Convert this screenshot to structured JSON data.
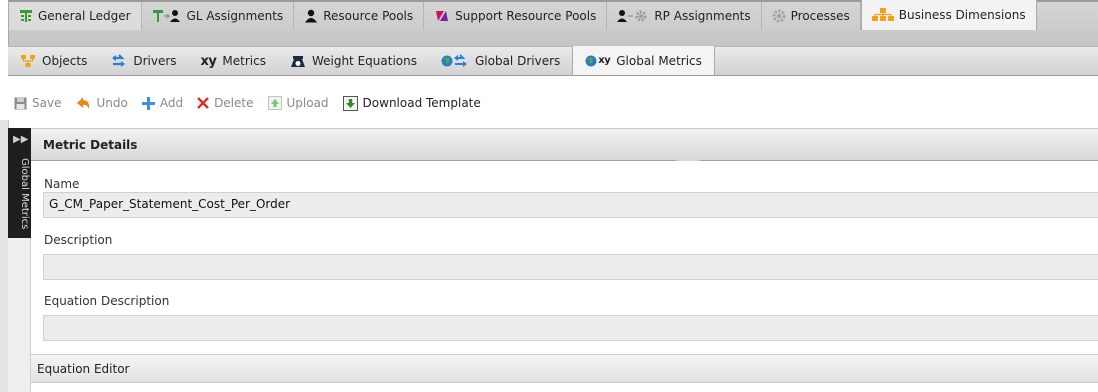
{
  "top_tabs": [
    {
      "label": "General Ledger",
      "icon": "general-ledger-icon"
    },
    {
      "label": "GL Assignments",
      "icon": "gl-assignments-icon"
    },
    {
      "label": "Resource Pools",
      "icon": "person-icon"
    },
    {
      "label": "Support Resource Pools",
      "icon": "support-pools-icon"
    },
    {
      "label": "RP Assignments",
      "icon": "rp-assignments-icon"
    },
    {
      "label": "Processes",
      "icon": "gear-icon"
    },
    {
      "label": "Business Dimensions",
      "icon": "business-dimensions-icon",
      "active": true
    }
  ],
  "sub_tabs": [
    {
      "label": "Objects",
      "icon": "objects-icon"
    },
    {
      "label": "Drivers",
      "icon": "drivers-icon"
    },
    {
      "label": "Metrics",
      "icon_text": "xy"
    },
    {
      "label": "Weight Equations",
      "icon": "scale-icon"
    },
    {
      "label": "Global Drivers",
      "icon": "globe-drivers-icon"
    },
    {
      "label": "Global Metrics",
      "icon_text": "xy",
      "active": true
    }
  ],
  "toolbar": {
    "save": "Save",
    "undo": "Undo",
    "add": "Add",
    "delete": "Delete",
    "upload": "Upload",
    "download_template": "Download Template"
  },
  "side_panel": {
    "label": "Global Metrics"
  },
  "panel": {
    "title": "Metric Details",
    "name_label": "Name",
    "name_value": "G_CM_Paper_Statement_Cost_Per_Order",
    "description_label": "Description",
    "description_value": "",
    "equation_description_label": "Equation Description",
    "equation_description_value": "",
    "equation_editor_label": "Equation Editor"
  },
  "colors": {
    "accent_orange": "#f0a21b",
    "accent_blue": "#2a7fd4",
    "delete_red": "#d93025",
    "ledger_green": "#3a9a3a"
  }
}
